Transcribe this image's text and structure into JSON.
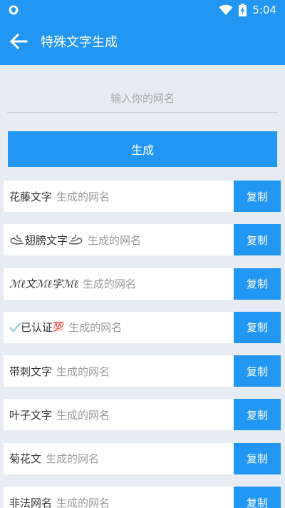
{
  "status_bar": {
    "time": "5:04",
    "icons": [
      "shield-badge-icon",
      "wifi-icon",
      "battery-charging-icon"
    ]
  },
  "app_bar": {
    "back_icon": "arrow-left-icon",
    "title": "特殊文字生成"
  },
  "input": {
    "placeholder": "输入你的网名",
    "value": ""
  },
  "generate_button": "生成",
  "copy_label": "复制",
  "result_placeholder": "生成的网名",
  "styles": [
    {
      "name": "花藤文字"
    },
    {
      "name": "翅膀文字",
      "decor": "wing-ornament"
    },
    {
      "name": "ℳℓ文ℳℓ字ℳℓ",
      "decor": "script"
    },
    {
      "name": "已认证",
      "decor": "verified-check",
      "badge": "💯"
    },
    {
      "name": "带刺文字"
    },
    {
      "name": "叶子文字"
    },
    {
      "name": "菊花文"
    },
    {
      "name": "非法网名"
    }
  ],
  "colors": {
    "accent": "#2196f3",
    "background": "#e6ebf4",
    "card": "#ffffff",
    "muted_text": "#9a9a9a"
  }
}
